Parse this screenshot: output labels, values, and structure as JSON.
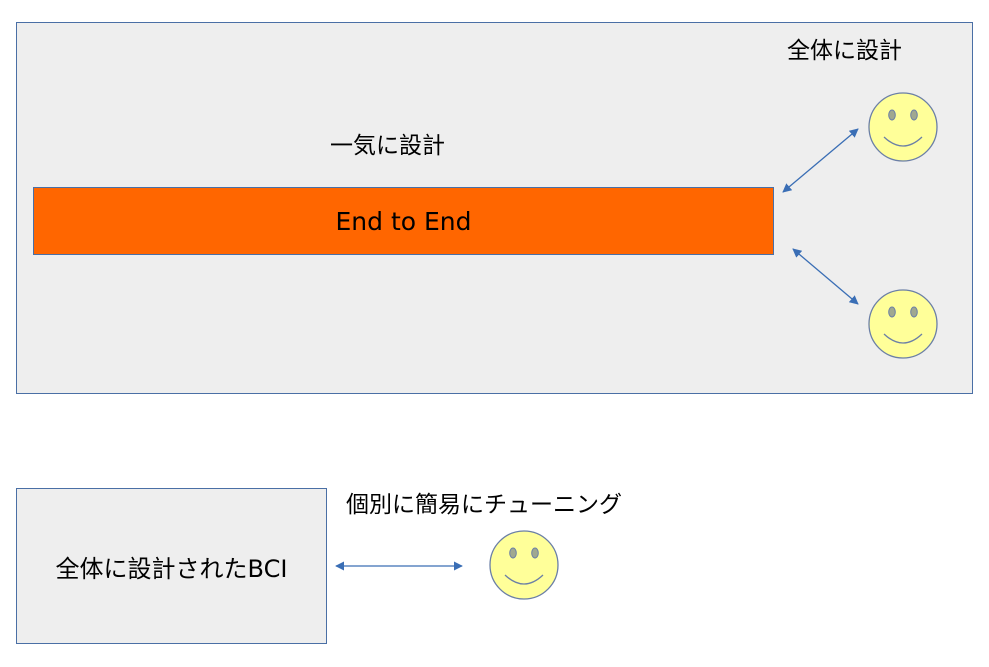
{
  "top_panel": {
    "fill": "#eeeeee",
    "design_whole_label": "全体に設計",
    "design_at_once_label": "一気に設計",
    "end_to_end_bar": {
      "label": "End to End",
      "fill": "#ff6600"
    }
  },
  "bottom_section": {
    "panel_label": "全体に設計されたBCI",
    "panel_fill": "#eeeeee",
    "tuning_label": "個別に簡易にチューニング"
  },
  "icons": {
    "face": "smiley-face-icon",
    "face_fill": "#ffff99",
    "face_stroke": "#6b7fa6",
    "arrow": "double-headed-arrow",
    "arrow_color": "#3a6eb5"
  }
}
